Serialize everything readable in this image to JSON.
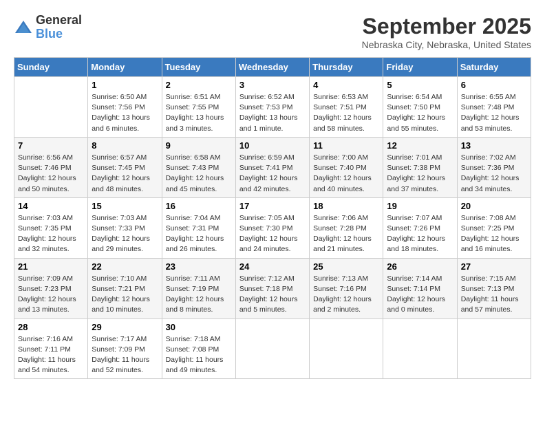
{
  "header": {
    "logo_general": "General",
    "logo_blue": "Blue",
    "title": "September 2025",
    "subtitle": "Nebraska City, Nebraska, United States"
  },
  "days_of_week": [
    "Sunday",
    "Monday",
    "Tuesday",
    "Wednesday",
    "Thursday",
    "Friday",
    "Saturday"
  ],
  "weeks": [
    [
      {
        "day": "",
        "sunrise": "",
        "sunset": "",
        "daylight": ""
      },
      {
        "day": "1",
        "sunrise": "Sunrise: 6:50 AM",
        "sunset": "Sunset: 7:56 PM",
        "daylight": "Daylight: 13 hours and 6 minutes."
      },
      {
        "day": "2",
        "sunrise": "Sunrise: 6:51 AM",
        "sunset": "Sunset: 7:55 PM",
        "daylight": "Daylight: 13 hours and 3 minutes."
      },
      {
        "day": "3",
        "sunrise": "Sunrise: 6:52 AM",
        "sunset": "Sunset: 7:53 PM",
        "daylight": "Daylight: 13 hours and 1 minute."
      },
      {
        "day": "4",
        "sunrise": "Sunrise: 6:53 AM",
        "sunset": "Sunset: 7:51 PM",
        "daylight": "Daylight: 12 hours and 58 minutes."
      },
      {
        "day": "5",
        "sunrise": "Sunrise: 6:54 AM",
        "sunset": "Sunset: 7:50 PM",
        "daylight": "Daylight: 12 hours and 55 minutes."
      },
      {
        "day": "6",
        "sunrise": "Sunrise: 6:55 AM",
        "sunset": "Sunset: 7:48 PM",
        "daylight": "Daylight: 12 hours and 53 minutes."
      }
    ],
    [
      {
        "day": "7",
        "sunrise": "Sunrise: 6:56 AM",
        "sunset": "Sunset: 7:46 PM",
        "daylight": "Daylight: 12 hours and 50 minutes."
      },
      {
        "day": "8",
        "sunrise": "Sunrise: 6:57 AM",
        "sunset": "Sunset: 7:45 PM",
        "daylight": "Daylight: 12 hours and 48 minutes."
      },
      {
        "day": "9",
        "sunrise": "Sunrise: 6:58 AM",
        "sunset": "Sunset: 7:43 PM",
        "daylight": "Daylight: 12 hours and 45 minutes."
      },
      {
        "day": "10",
        "sunrise": "Sunrise: 6:59 AM",
        "sunset": "Sunset: 7:41 PM",
        "daylight": "Daylight: 12 hours and 42 minutes."
      },
      {
        "day": "11",
        "sunrise": "Sunrise: 7:00 AM",
        "sunset": "Sunset: 7:40 PM",
        "daylight": "Daylight: 12 hours and 40 minutes."
      },
      {
        "day": "12",
        "sunrise": "Sunrise: 7:01 AM",
        "sunset": "Sunset: 7:38 PM",
        "daylight": "Daylight: 12 hours and 37 minutes."
      },
      {
        "day": "13",
        "sunrise": "Sunrise: 7:02 AM",
        "sunset": "Sunset: 7:36 PM",
        "daylight": "Daylight: 12 hours and 34 minutes."
      }
    ],
    [
      {
        "day": "14",
        "sunrise": "Sunrise: 7:03 AM",
        "sunset": "Sunset: 7:35 PM",
        "daylight": "Daylight: 12 hours and 32 minutes."
      },
      {
        "day": "15",
        "sunrise": "Sunrise: 7:03 AM",
        "sunset": "Sunset: 7:33 PM",
        "daylight": "Daylight: 12 hours and 29 minutes."
      },
      {
        "day": "16",
        "sunrise": "Sunrise: 7:04 AM",
        "sunset": "Sunset: 7:31 PM",
        "daylight": "Daylight: 12 hours and 26 minutes."
      },
      {
        "day": "17",
        "sunrise": "Sunrise: 7:05 AM",
        "sunset": "Sunset: 7:30 PM",
        "daylight": "Daylight: 12 hours and 24 minutes."
      },
      {
        "day": "18",
        "sunrise": "Sunrise: 7:06 AM",
        "sunset": "Sunset: 7:28 PM",
        "daylight": "Daylight: 12 hours and 21 minutes."
      },
      {
        "day": "19",
        "sunrise": "Sunrise: 7:07 AM",
        "sunset": "Sunset: 7:26 PM",
        "daylight": "Daylight: 12 hours and 18 minutes."
      },
      {
        "day": "20",
        "sunrise": "Sunrise: 7:08 AM",
        "sunset": "Sunset: 7:25 PM",
        "daylight": "Daylight: 12 hours and 16 minutes."
      }
    ],
    [
      {
        "day": "21",
        "sunrise": "Sunrise: 7:09 AM",
        "sunset": "Sunset: 7:23 PM",
        "daylight": "Daylight: 12 hours and 13 minutes."
      },
      {
        "day": "22",
        "sunrise": "Sunrise: 7:10 AM",
        "sunset": "Sunset: 7:21 PM",
        "daylight": "Daylight: 12 hours and 10 minutes."
      },
      {
        "day": "23",
        "sunrise": "Sunrise: 7:11 AM",
        "sunset": "Sunset: 7:19 PM",
        "daylight": "Daylight: 12 hours and 8 minutes."
      },
      {
        "day": "24",
        "sunrise": "Sunrise: 7:12 AM",
        "sunset": "Sunset: 7:18 PM",
        "daylight": "Daylight: 12 hours and 5 minutes."
      },
      {
        "day": "25",
        "sunrise": "Sunrise: 7:13 AM",
        "sunset": "Sunset: 7:16 PM",
        "daylight": "Daylight: 12 hours and 2 minutes."
      },
      {
        "day": "26",
        "sunrise": "Sunrise: 7:14 AM",
        "sunset": "Sunset: 7:14 PM",
        "daylight": "Daylight: 12 hours and 0 minutes."
      },
      {
        "day": "27",
        "sunrise": "Sunrise: 7:15 AM",
        "sunset": "Sunset: 7:13 PM",
        "daylight": "Daylight: 11 hours and 57 minutes."
      }
    ],
    [
      {
        "day": "28",
        "sunrise": "Sunrise: 7:16 AM",
        "sunset": "Sunset: 7:11 PM",
        "daylight": "Daylight: 11 hours and 54 minutes."
      },
      {
        "day": "29",
        "sunrise": "Sunrise: 7:17 AM",
        "sunset": "Sunset: 7:09 PM",
        "daylight": "Daylight: 11 hours and 52 minutes."
      },
      {
        "day": "30",
        "sunrise": "Sunrise: 7:18 AM",
        "sunset": "Sunset: 7:08 PM",
        "daylight": "Daylight: 11 hours and 49 minutes."
      },
      {
        "day": "",
        "sunrise": "",
        "sunset": "",
        "daylight": ""
      },
      {
        "day": "",
        "sunrise": "",
        "sunset": "",
        "daylight": ""
      },
      {
        "day": "",
        "sunrise": "",
        "sunset": "",
        "daylight": ""
      },
      {
        "day": "",
        "sunrise": "",
        "sunset": "",
        "daylight": ""
      }
    ]
  ]
}
